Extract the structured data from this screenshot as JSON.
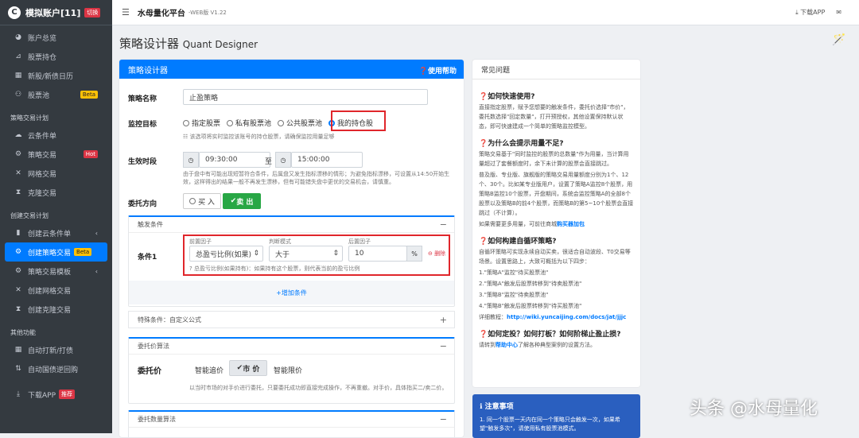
{
  "sidebar": {
    "brand_logo": "C",
    "account": "模拟账户[11]",
    "switch": "切换",
    "items_top": [
      {
        "icon": "dashboard-icon",
        "label": "账户总览"
      },
      {
        "icon": "chart-icon",
        "label": "股票持仓"
      },
      {
        "icon": "calendar-icon",
        "label": "新股/新债日历"
      },
      {
        "icon": "pool-icon",
        "label": "股票池",
        "badge": "Beta"
      }
    ],
    "section_trade": "策略交易计划",
    "items_trade": [
      {
        "icon": "cloud-icon",
        "label": "云条件单"
      },
      {
        "icon": "strategy-icon",
        "label": "策略交易",
        "badge": "Hot"
      },
      {
        "icon": "grid-icon",
        "label": "网格交易"
      },
      {
        "icon": "hourglass-icon",
        "label": "克隆交易"
      }
    ],
    "section_create": "创建交易计划",
    "items_create": [
      {
        "icon": "file-icon",
        "label": "创建云条件单"
      },
      {
        "icon": "gears-icon",
        "label": "创建策略交易",
        "badge": "Beta"
      },
      {
        "icon": "template-icon",
        "label": "策略交易模板"
      },
      {
        "icon": "shuffle-icon",
        "label": "创建网格交易"
      },
      {
        "icon": "hourglass-icon",
        "label": "创建克隆交易"
      }
    ],
    "section_other": "其他功能",
    "items_other": [
      {
        "icon": "calendar-icon",
        "label": "自动打新/打债"
      },
      {
        "icon": "sort-icon",
        "label": "自动国债逆回购"
      }
    ],
    "download": "下载APP",
    "download_badge": "推荐"
  },
  "topbar": {
    "title": "水母量化平台",
    "version": "-WEB版 V1.22",
    "download": "下载APP"
  },
  "page": {
    "title": "策略设计器",
    "subtitle": "Quant Designer"
  },
  "designer": {
    "header": "策略设计器",
    "help": "使用帮助",
    "name_label": "策略名称",
    "name_value": "止盈策略",
    "target_label": "监控目标",
    "targets": [
      "指定股票",
      "私有股票池",
      "公共股票池",
      "我的持仓股"
    ],
    "target_selected": "我的持仓股",
    "target_hint": "该选项将实时监控该账号的持仓股票，请确保监控用量足够",
    "period_label": "生效时段",
    "time_start": "09:30:00",
    "time_to": "至",
    "time_end": "15:00:00",
    "period_hint": "由于盘中有可能出现短暂符合条件，后属盘又发生指标漂移的情形；为避免指标漂移，可设置从14:50开始生效，这样得出的结果一般不再发生漂移，但有可能错失盘中更优的交易机会，请慎重。",
    "direction_label": "委托方向",
    "buy": "买 入",
    "sell": "卖 出"
  },
  "trigger": {
    "header": "触发条件",
    "cond_label": "条件1",
    "front_label": "前置因子",
    "mode_label": "判断模式",
    "back_label": "后置因子",
    "front_value": "总盈亏比例(如果)",
    "mode_value": "大于",
    "back_value": "10",
    "unit": "%",
    "delete": "删除",
    "cond_hint": "总盈亏比例(如果持有)：如果持有这个股票，则代表当前的盈亏比例",
    "add": "增加条件"
  },
  "special": {
    "label": "特殊条件：自定义公式"
  },
  "price_algo": {
    "header": "委托价算法",
    "label": "委托价",
    "options": [
      "智能追价",
      "市 价",
      "智能限价"
    ],
    "selected": "市 价",
    "hint": "以当时市场的对手价进行委托，只要委托成功即直接完成操作，不再重撤。对手价，具体指买二/卖二价。"
  },
  "qty_algo": {
    "header": "委托数量算法"
  },
  "faq": {
    "header": "常见问题",
    "q1": "如何快速使用?",
    "a1": "直接指定股票，赋予您想要的触发条件，委托价选择\"市价\"，委托数选择\"回定数量\"，打开预授权，其他设置保持默认状态，即可快速建成一个简单的策略监控模型。",
    "q2": "为什么会提示用量不足?",
    "a2a": "策略交易基于\"同时监控的股票的总数量\"作为用量，当计算用量超过了套餐额度时，余下未计算的股票会直接跳过。",
    "a2b": "普及版、专业版、旗舰版的策略交易用量额度分别为1个、12个、30个。比如某专业版用户，设置了策略A监控8个股票，用策略B监控10个股票，开盘期间，系统会监控策略A的全部8个股票以及策略B的前4个股票，而策略B的第5~10个股票会直接跳过（不计算）。",
    "a2c_text": "如果需要更多用量，可前往商城",
    "a2c_link": "购买器加包",
    "q3": "如何构建自循环策略?",
    "a3": "自循环策略可实现永续自动买卖，很适合自动波段、T0交易等场景。设置思路上，大致可概括为以下四步：",
    "steps": [
      "1.\"策略A\"监控\"待买股票池\"",
      "2.\"策略A\"触发后股票转移到\"待卖股票池\"",
      "3.\"策略B\"监控\"待卖股票池\"",
      "4.\"策略B\"触发后股票转移到\"待买股票池\""
    ],
    "detail_label": "详细教程：",
    "detail_link": "http://wiki.yuncaijing.com/docs/jat/jjjc",
    "q4": "如何定投？如何打板？如何阶梯止盈止损?",
    "a4a": "请转到",
    "a4link": "帮助中心",
    "a4b": "了解各种典型案例的设置方法。"
  },
  "note": {
    "title": "注意事项",
    "body": "1. 同一个股票一天内在同一个策略只会触发一次，如果希望\"触发多次\"，请使用私有股票池模式。"
  },
  "watermark": "头条 @水母量化"
}
